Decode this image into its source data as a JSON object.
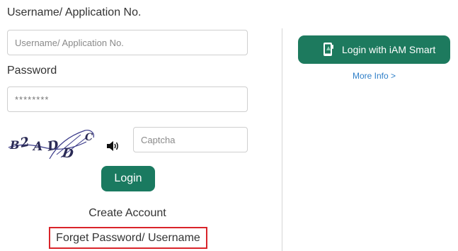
{
  "form": {
    "username_label": "Username/ Application No.",
    "username_placeholder": "Username/ Application No.",
    "password_label": "Password",
    "password_placeholder": "********",
    "captcha_text": "B2ADDC",
    "captcha_placeholder": "Captcha",
    "login_label": "Login",
    "create_account_label": "Create Account",
    "forget_label": "Forget Password/ Username"
  },
  "iam": {
    "button_label": "Login with iAM Smart",
    "more_info_label": "More Info >"
  },
  "colors": {
    "primary_green": "#1a7a60",
    "link_blue": "#2f7fc8",
    "highlight_red": "#d9242a"
  },
  "icons": {
    "speaker": "speaker-icon",
    "iam": "iam-smart-phone-icon"
  }
}
